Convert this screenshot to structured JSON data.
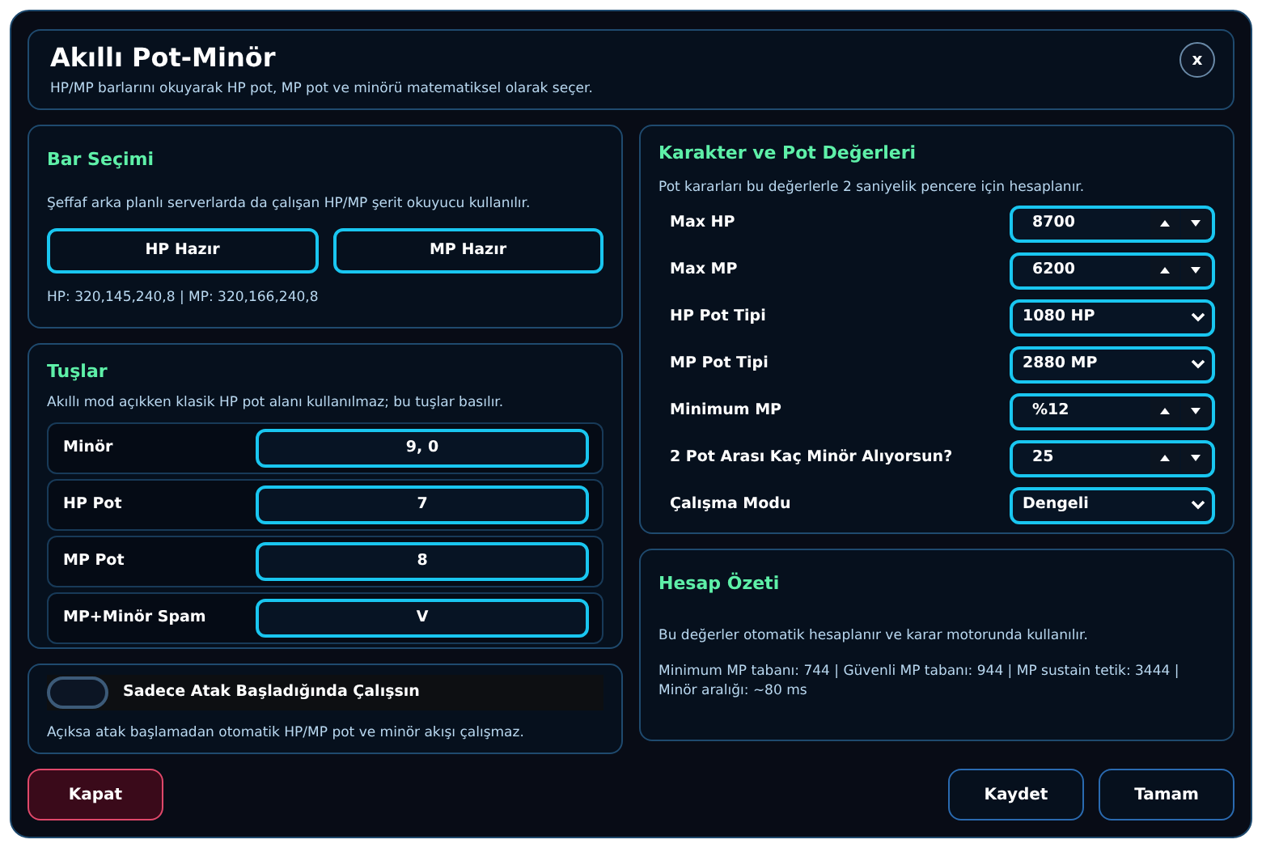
{
  "header": {
    "title": "Akıllı Pot-Minör",
    "subtitle": "HP/MP barlarını okuyarak HP pot, MP pot ve minörü matematiksel olarak seçer.",
    "close": "x"
  },
  "bar_selection": {
    "title": "Bar Seçimi",
    "description": "Şeffaf arka planlı serverlarda da çalışan HP/MP şerit okuyucu kullanılır.",
    "buttons": [
      "HP Hazır",
      "MP Hazır"
    ],
    "readout": "HP: 320,145,240,8 | MP: 320,166,240,8"
  },
  "keys": {
    "title": "Tuşlar",
    "description": "Akıllı mod açıkken klasik HP pot alanı kullanılmaz; bu tuşlar basılır.",
    "rows": [
      {
        "label": "Minör",
        "value": "9, 0"
      },
      {
        "label": "HP Pot",
        "value": "7"
      },
      {
        "label": "MP Pot",
        "value": "8"
      },
      {
        "label": "MP+Minör Spam",
        "value": "V"
      }
    ]
  },
  "attack_only": {
    "label": "Sadece Atak Başladığında Çalışsın",
    "on": false,
    "description": "Açıksa atak başlamadan otomatik HP/MP pot ve minör akışı çalışmaz."
  },
  "character": {
    "title": "Karakter ve Pot Değerleri",
    "description": "Pot kararları bu değerlerle 2 saniyelik pencere için hesaplanır.",
    "fields": [
      {
        "label": "Max HP",
        "value": "8700",
        "kind": "spinner"
      },
      {
        "label": "Max MP",
        "value": "6200",
        "kind": "spinner"
      },
      {
        "label": "HP Pot Tipi",
        "value": "1080 HP",
        "kind": "select"
      },
      {
        "label": "MP Pot Tipi",
        "value": "2880 MP",
        "kind": "select"
      },
      {
        "label": "Minimum MP",
        "value": "%12",
        "kind": "spinner"
      },
      {
        "label": "2 Pot Arası Kaç Minör Alıyorsun?",
        "value": "25",
        "kind": "spinner"
      },
      {
        "label": "Çalışma Modu",
        "value": "Dengeli",
        "kind": "select"
      }
    ]
  },
  "summary": {
    "title": "Hesap Özeti",
    "description": "Bu değerler otomatik hesaplanır ve karar motorunda kullanılır.",
    "details": "Minimum MP tabanı: 744 | Güvenli MP tabanı: 944 | MP sustain tetik: 3444 | Minör aralığı: ~80 ms"
  },
  "footer": {
    "close_button": "Kapat",
    "buttons": [
      "Kaydet",
      "Tamam"
    ]
  }
}
